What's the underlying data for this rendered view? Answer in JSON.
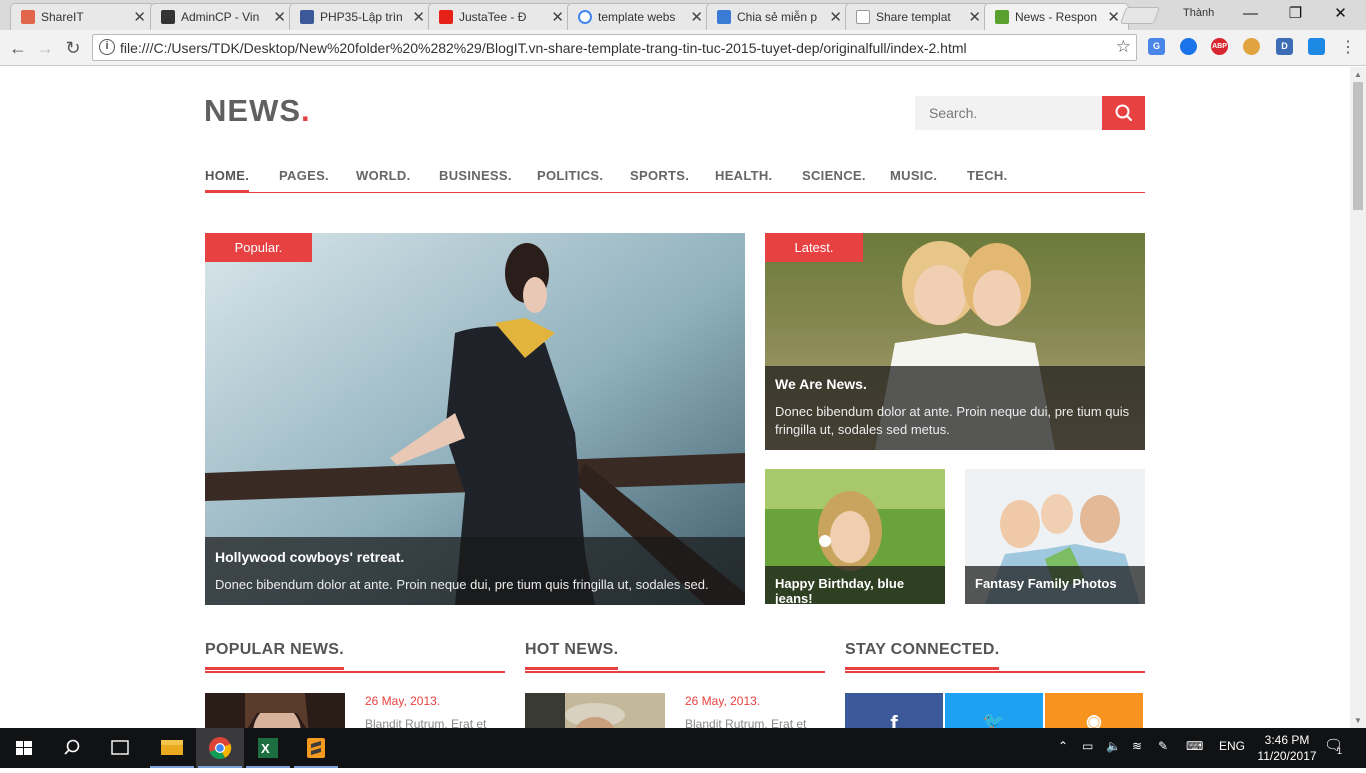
{
  "browser": {
    "tabs": [
      {
        "title": "ShareIT",
        "favicon_color": "#e0654a"
      },
      {
        "title": "AdminCP - Vin",
        "favicon_color": "#333333"
      },
      {
        "title": "PHP35-Lập trìn",
        "favicon_color": "#3b5998"
      },
      {
        "title": "JustaTee - Đ",
        "favicon_color": "#e62117"
      },
      {
        "title": "template webs",
        "favicon_color": "#4285f4"
      },
      {
        "title": "Chia sẻ miễn p",
        "favicon_color": "#3a7bd5"
      },
      {
        "title": "Share templat",
        "favicon_color": "#bbbbbb"
      },
      {
        "title": "News - Respon",
        "favicon_color": "#5aa02c"
      }
    ],
    "profile_name": "Thành",
    "url": "file:///C:/Users/TDK/Desktop/New%20folder%20%282%29/BlogIT.vn-share-template-trang-tin-tuc-2015-tuyet-dep/originalfull/index-2.html",
    "extensions": [
      {
        "name": "translate-icon",
        "color": "#4a86e8",
        "label": "G"
      },
      {
        "name": "globe-icon",
        "color": "#1a73e8",
        "label": ""
      },
      {
        "name": "adblock-icon",
        "color": "#d8262f",
        "label": "ABP"
      },
      {
        "name": "lock-extension-icon",
        "color": "#e0a340",
        "label": ""
      },
      {
        "name": "d-extension-icon",
        "color": "#3c6db5",
        "label": "D"
      },
      {
        "name": "save-extension-icon",
        "color": "#1e88e5",
        "label": ""
      }
    ]
  },
  "site": {
    "logo": "NEWS",
    "logo_dot": ".",
    "search_placeholder": "Search.",
    "menu": [
      "HOME.",
      "PAGES.",
      "WORLD.",
      "BUSINESS.",
      "POLITICS.",
      "SPORTS.",
      "HEALTH.",
      "SCIENCE.",
      "MUSIC.",
      "TECH."
    ],
    "accent_color": "#e84142",
    "featured": {
      "badge": "Popular.",
      "title": "Hollywood cowboys' retreat.",
      "text": "Donec bibendum dolor at ante. Proin neque dui, pre tium quis fringilla ut, sodales sed."
    },
    "latest": {
      "badge": "Latest.",
      "title": "We Are News.",
      "text": "Donec bibendum dolor at ante. Proin neque dui, pre tium quis fringilla ut, sodales sed metus."
    },
    "small_cards": [
      {
        "title": "Happy Birthday, blue jeans!"
      },
      {
        "title": "Fantasy Family Photos"
      }
    ],
    "sections": {
      "popular": "POPULAR NEWS.",
      "hot": "HOT NEWS.",
      "stay": "STAY CONNECTED."
    },
    "news_items": [
      {
        "date": "26 May, 2013.",
        "snippet": "Blandit Rutrum, Erat et"
      },
      {
        "date": "26 May, 2013.",
        "snippet": "Blandit Rutrum, Erat et"
      }
    ],
    "social": [
      {
        "icon": "facebook-icon",
        "glyph": "f",
        "color": "#3b5998"
      },
      {
        "icon": "twitter-icon",
        "glyph": "🐦",
        "color": "#1da1f2"
      },
      {
        "icon": "rss-icon",
        "glyph": "◉",
        "color": "#f7931e"
      }
    ]
  },
  "taskbar": {
    "language": "ENG",
    "time": "3:46 PM",
    "date": "11/20/2017",
    "notifications": "1"
  }
}
